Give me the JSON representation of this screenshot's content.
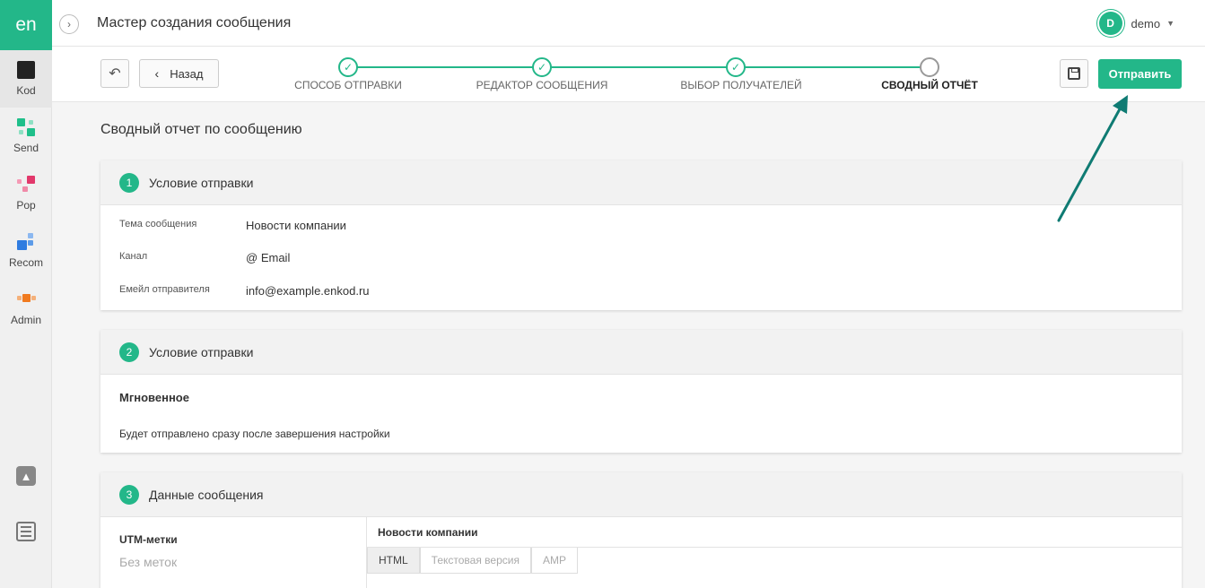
{
  "sidebar": {
    "logo": "en",
    "items": [
      {
        "label": "Kod"
      },
      {
        "label": "Send"
      },
      {
        "label": "Pop"
      },
      {
        "label": "Recom"
      },
      {
        "label": "Admin"
      }
    ],
    "bottom_icons": [
      "bell-icon",
      "sliders-icon"
    ]
  },
  "header": {
    "title": "Мастер создания сообщения",
    "user_initial": "D",
    "user_name": "demo"
  },
  "toolbar": {
    "back_label": "Назад",
    "send_label": "Отправить",
    "steps": [
      {
        "label": "Способ отправки",
        "state": "done"
      },
      {
        "label": "Редактор сообщения",
        "state": "done"
      },
      {
        "label": "Выбор получателей",
        "state": "done"
      },
      {
        "label": "Сводный отчёт",
        "state": "current"
      }
    ]
  },
  "main": {
    "title": "Сводный отчет по сообщению",
    "section1": {
      "number": "1",
      "title": "Условие отправки",
      "subject_label": "Тема сообщения",
      "subject_value": "Новости компании",
      "channel_label": "Канал",
      "channel_icon": "@",
      "channel_value": "Email",
      "sender_label": "Емейл отправителя",
      "sender_value": "info@example.enkod.ru"
    },
    "section2": {
      "number": "2",
      "title": "Условие отправки",
      "mode": "Мгновенное",
      "description": "Будет отправлено сразу после завершения настройки"
    },
    "section3": {
      "number": "3",
      "title": "Данные сообщения",
      "utm_label": "UTM-метки",
      "utm_value": "Без меток",
      "message_name": "Новости компании",
      "tabs": [
        "HTML",
        "Текстовая версия",
        "AMP"
      ],
      "active_tab": "HTML"
    }
  },
  "colors": {
    "accent": "#23b789",
    "annotation_arrow": "#0f7b73"
  }
}
